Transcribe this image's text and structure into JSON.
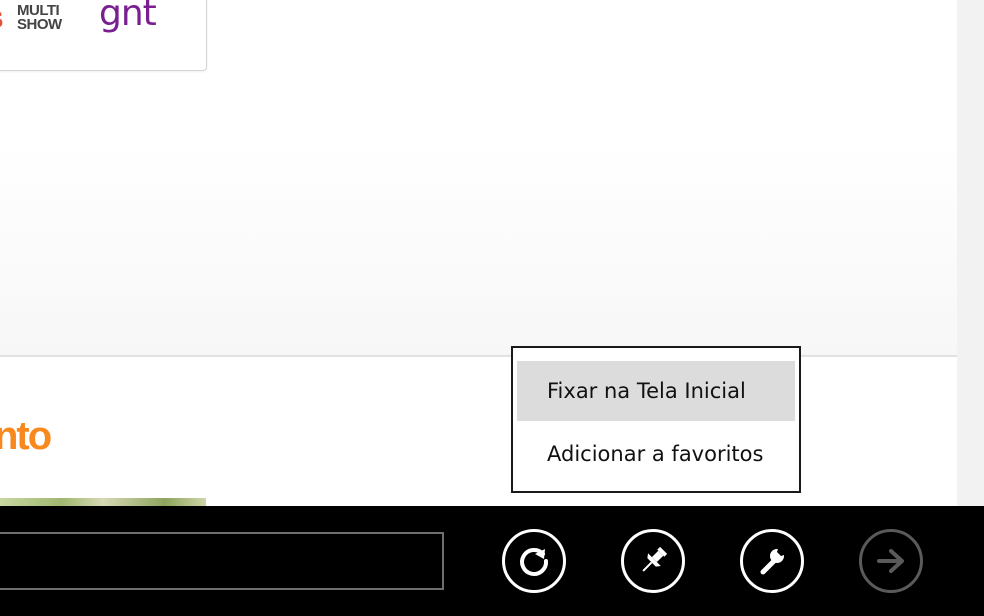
{
  "logos": {
    "partial": "s",
    "multishow_line1": "MULTI",
    "multishow_line2": "SHOW",
    "gnt": "gnt"
  },
  "section": {
    "heading": "nto"
  },
  "context_menu": {
    "items": [
      {
        "label": "Fixar na Tela Inicial",
        "highlighted": true
      },
      {
        "label": "Adicionar a favoritos",
        "highlighted": false
      }
    ]
  },
  "app_bar": {
    "address_value": "",
    "buttons": [
      {
        "icon": "refresh-icon",
        "enabled": true
      },
      {
        "icon": "pin-icon",
        "enabled": true
      },
      {
        "icon": "wrench-icon",
        "enabled": true
      },
      {
        "icon": "forward-arrow-icon",
        "enabled": false
      }
    ]
  },
  "colors": {
    "app_bar": "#000000",
    "menu_highlight": "#dcdcdc",
    "accent_orange": "#f7891f",
    "gnt_purple": "#7a1f91",
    "disabled_button": "#5a5a5a"
  }
}
